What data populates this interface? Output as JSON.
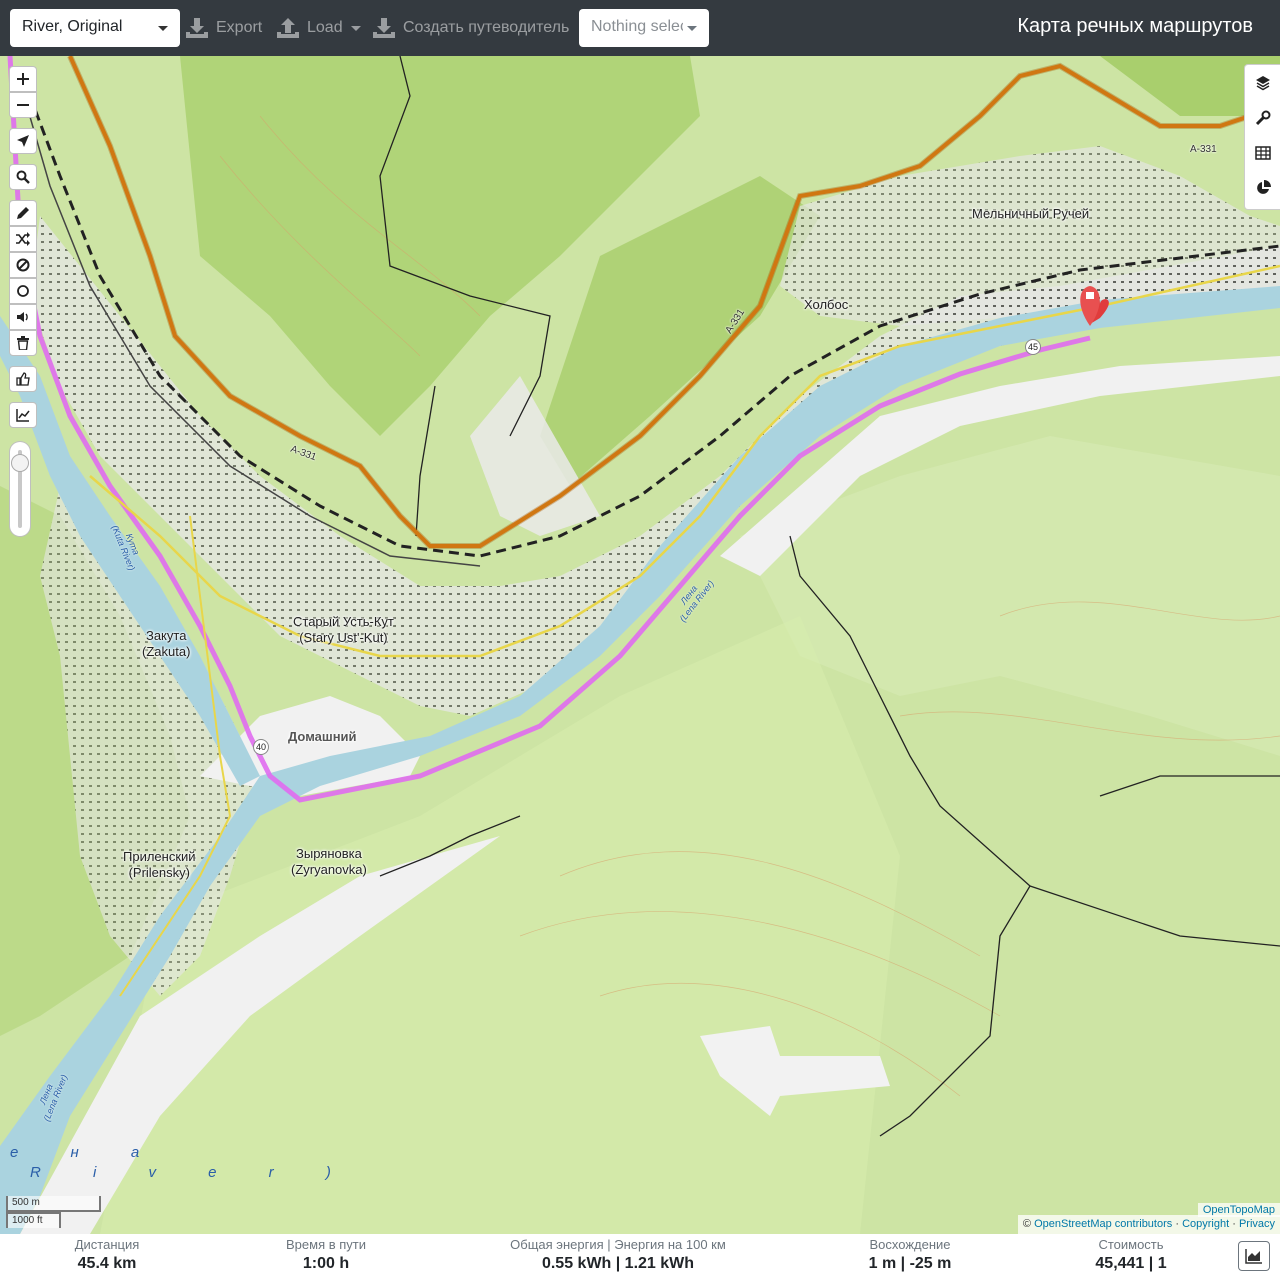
{
  "navbar": {
    "profile": "River, Original",
    "export": "Export",
    "load": "Load",
    "guide": "Создать путеводитель",
    "nothing_selected": "Nothing selected",
    "brand": "Карта речных маршрутов"
  },
  "map": {
    "places": {
      "melnichny": "Мельничный Ручей",
      "kholbos": "Холбос",
      "stary_ust_kut_ru": "Старый Усть-Кут",
      "stary_ust_kut_en": "(Stary Ust'-Kut)",
      "zakuta_ru": "Закута",
      "zakuta_en": "(Zakuta)",
      "domashny": "Домашний",
      "prilensky_ru": "Приленский",
      "prilensky_en": "(Prilensky)",
      "zyryanovka_ru": "Зыряновка",
      "zyryanovka_en": "(Zyryanovka)"
    },
    "rivers": {
      "lena_mid_ru": "Лена",
      "lena_mid_en": "(Lena River)",
      "kuta_ru": "Кута",
      "kuta_en": "(Kuta River)",
      "lena_sw_ru": "Лена",
      "lena_sw_en": "(Lena River)",
      "lena_big_1": "е н а",
      "lena_big_2": "R i v e r )"
    },
    "roads": {
      "a331_a": "A-331",
      "a331_b": "A-331",
      "a331_c": "A-331"
    },
    "shields": {
      "s45": "45",
      "s40": "40"
    },
    "toolbar": [
      "zoom-in",
      "zoom-out",
      "locate",
      "search",
      "draw-route",
      "reverse-route",
      "avoid-area",
      "poi",
      "voice-hints",
      "delete",
      "customize",
      "elevation"
    ],
    "scale": {
      "metric": "500 m",
      "imperial": "1000 ft"
    },
    "attribution": {
      "topo": "OpenTopoMap",
      "prefix": "©",
      "osm": "OpenStreetMap contributors",
      "copyright": "Copyright",
      "privacy": "Privacy",
      "sep": "·"
    },
    "colors": {
      "water": "#aad3df",
      "route": "#e06cf0",
      "forest": "#c8e09c",
      "road_orange": "#e8891c",
      "marker": "#e03c3c"
    }
  },
  "stats": {
    "distance_label": "Дистанция",
    "distance": "45.4 km",
    "time_label": "Время в пути",
    "time": "1:00 h",
    "energy_label": "Общая энергия | Энергия на 100 км",
    "energy": "0.55 kWh | 1.21 kWh",
    "ascent_label": "Восхождение",
    "ascent": "1 m | -25 m",
    "cost_label": "Стоимость",
    "cost": "45,441 | 1"
  }
}
